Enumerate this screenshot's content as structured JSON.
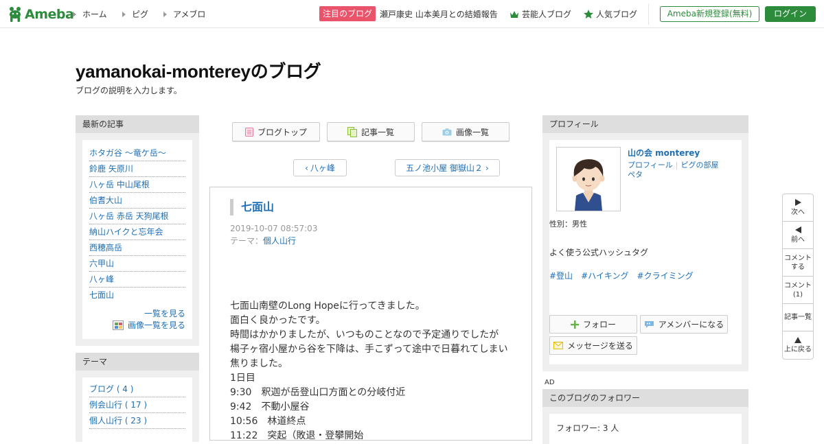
{
  "header": {
    "logo_text": "Ameba",
    "nav": [
      "ホーム",
      "ピグ",
      "アメブロ"
    ],
    "featured_badge": "注目のブログ",
    "featured_headline": "瀬戸康史 山本美月との結婚報告",
    "celeb_blog": "芸能人ブログ",
    "popular_blog": "人気ブログ",
    "register": "Ameba新規登録(無料)",
    "login": "ログイン",
    "brand_color": "#2d8c3c"
  },
  "blog": {
    "title": "yamanokai-montereyのブログ",
    "description": "ブログの説明を入力します。"
  },
  "left": {
    "recent_header": "最新の記事",
    "recent": [
      "ホタガ谷 ～竜ケ岳～",
      "鈴鹿 矢原川",
      "八ヶ岳 中山尾根",
      "伯耆大山",
      "八ヶ岳 赤岳 天狗尾根",
      "納山ハイクと忘年会",
      "西穂高岳",
      "六甲山",
      "八ヶ峰",
      "七面山"
    ],
    "see_all": "一覧を見る",
    "see_images": "画像一覧を見る",
    "theme_header": "テーマ",
    "themes": [
      "ブログ ( 4 )",
      "例会山行 ( 17 )",
      "個人山行 ( 23 )"
    ]
  },
  "center": {
    "blog_top": "ブログトップ",
    "entry_list": "記事一覧",
    "image_list": "画像一覧",
    "prev": "八ヶ峰",
    "next": "五ノ池小屋 御嶽山２"
  },
  "article": {
    "title": "七面山",
    "date": "2019-10-07 08:57:03",
    "theme_label": "テーマ：",
    "theme": "個人山行",
    "body": [
      "七面山南壁のLong Hopeに行ってきました。",
      "面白く良かったです。",
      "時間はかかりましたが、いつものことなので予定通りでしたが",
      "楊子ヶ宿小屋から谷を下降は、手こずって途中で日暮れてしまい",
      "焦りました。",
      "1日目",
      "9:30　釈迦が岳登山口方面との分岐付近",
      "9:42　不動小屋谷",
      "10:56　林道終点",
      "11:22　突起（敗退・登攀開始"
    ]
  },
  "right": {
    "profile_header": "プロフィール",
    "name": "山の会 monterey",
    "profile_link": "プロフィール",
    "pig_link": "ピグの部屋",
    "peta": "ペタ",
    "gender": "性別：男性",
    "hashtag_header": "よく使う公式ハッシュタグ",
    "tags": [
      "#登山",
      "#ハイキング",
      "#クライミング"
    ],
    "follow": "フォロー",
    "amember": "アメンバーになる",
    "message": "メッセージを送る",
    "ad": "AD",
    "followers_header": "このブログのフォロワー",
    "followers": "フォロワー: 3 人"
  },
  "floater": {
    "next": "次へ",
    "prev": "前へ",
    "comment_line1": "コメント",
    "comment_line2": "する",
    "comments_line1": "コメント",
    "comments_line2": "(1)",
    "entry_list": "記事一覧",
    "top": "上に戻る"
  }
}
